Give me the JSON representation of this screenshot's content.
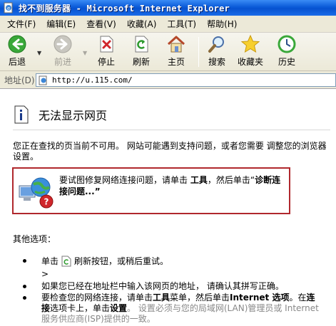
{
  "window": {
    "title": "找不到服务器 - Microsoft Internet Explorer"
  },
  "menu": {
    "items": [
      {
        "label": "文件(F)"
      },
      {
        "label": "编辑(E)"
      },
      {
        "label": "查看(V)"
      },
      {
        "label": "收藏(A)"
      },
      {
        "label": "工具(T)"
      },
      {
        "label": "帮助(H)"
      }
    ]
  },
  "toolbar": {
    "back": "后退",
    "forward": "前进",
    "stop": "停止",
    "refresh": "刷新",
    "home": "主页",
    "search": "搜索",
    "favorites": "收藏夹",
    "history": "历史"
  },
  "address": {
    "label": "地址(D)",
    "url": "http://u.115.com/"
  },
  "page": {
    "heading": "无法显示网页",
    "intro": "您正在查找的页当前不可用。 网站可能遇到支持问题，或者您需要 调整您的浏览器设置。",
    "diag_prefix": "要试图修复网络连接问题，请单击 ",
    "diag_tools": "工具",
    "diag_mid": "，然后单击“",
    "diag_link": "诊断连接问题...",
    "diag_suffix": "”",
    "other_label": "其他选项：",
    "opt1_prefix": "单击",
    "opt1_suffix": "刷新按钮，或稍后重试。",
    "arrow": ">",
    "opt2": "如果您已经在地址栏中输入该网页的地址， 请确认其拼写正确。",
    "opt3_a": "要检查您的网络连接，请单击",
    "opt3_b": "工具",
    "opt3_c": "菜单，然后单击",
    "opt3_d": "Internet 选项",
    "opt3_e": "。在",
    "opt3_f": "连接",
    "opt3_g": "选项卡上，单击",
    "opt3_h": "设置",
    "opt3_i": "。 设置必须与您的局域网(LAN)管理员或 Internet 服务供应商(ISP)提供的一致。"
  },
  "colors": {
    "titlebar": "#0a5ad8",
    "menubar": "#ece9d8",
    "highlight_border": "#b0282d"
  }
}
